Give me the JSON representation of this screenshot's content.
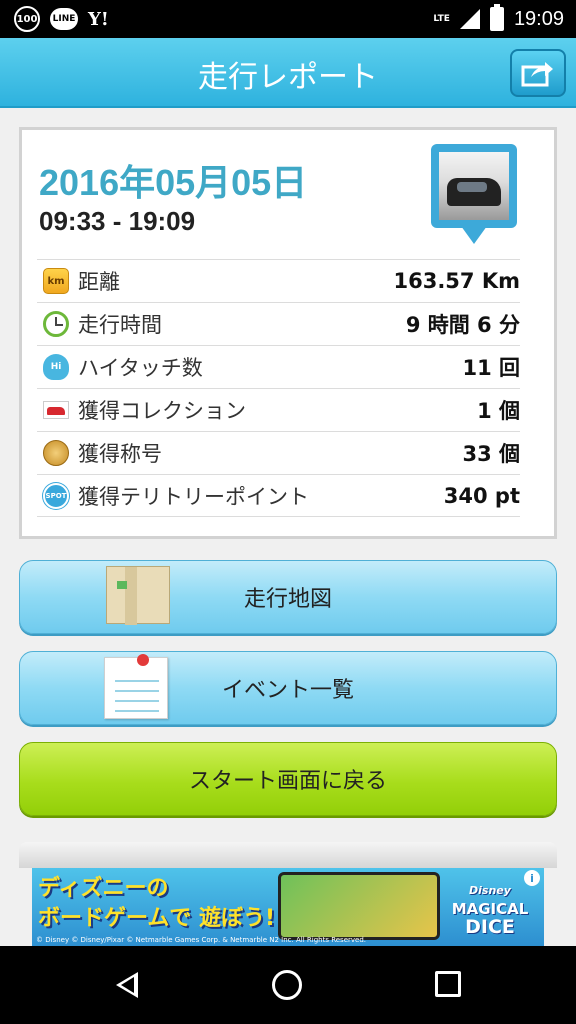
{
  "status_bar": {
    "badge": "100",
    "app_line": "LINE",
    "app_yahoo": "Y!",
    "network": "LTE",
    "time": "19:09"
  },
  "header": {
    "title": "走行レポート"
  },
  "report": {
    "date": "2016年05月05日",
    "time_range": "09:33 - 19:09",
    "stats": [
      {
        "icon": "km-icon",
        "icon_text": "km",
        "label": "距離",
        "value": "163.57 Km"
      },
      {
        "icon": "clock-icon",
        "label": "走行時間",
        "value": "9 時間 6 分"
      },
      {
        "icon": "high-touch-hand-icon",
        "icon_text": "Hi",
        "label": "ハイタッチ数",
        "value": "11 回"
      },
      {
        "icon": "car-icon",
        "label": "獲得コレクション",
        "value": "1 個"
      },
      {
        "icon": "medal-icon",
        "label": "獲得称号",
        "value": "33 個"
      },
      {
        "icon": "spot-icon",
        "icon_text": "SPOT",
        "label": "獲得テリトリーポイント",
        "value": "340 pt"
      }
    ]
  },
  "buttons": {
    "map": "走行地図",
    "events": "イベント一覧",
    "back_to_start": "スタート画面に戻る"
  },
  "ad": {
    "headline_line1": "ディズニーの",
    "headline_line2": "ボードゲームで 遊ぼう!",
    "logo_brand": "Disney",
    "logo_line1": "MAGICAL",
    "logo_line2": "DICE",
    "info": "i",
    "copyright": "© Disney © Disney/Pixar © Netmarble Games Corp. & Netmarble N2 Inc. All Rights Reserved."
  },
  "colors": {
    "header": "#2eb2de",
    "date": "#3fa8c6",
    "button_blue": "#8fdaf4",
    "button_green": "#a8dd1c"
  }
}
